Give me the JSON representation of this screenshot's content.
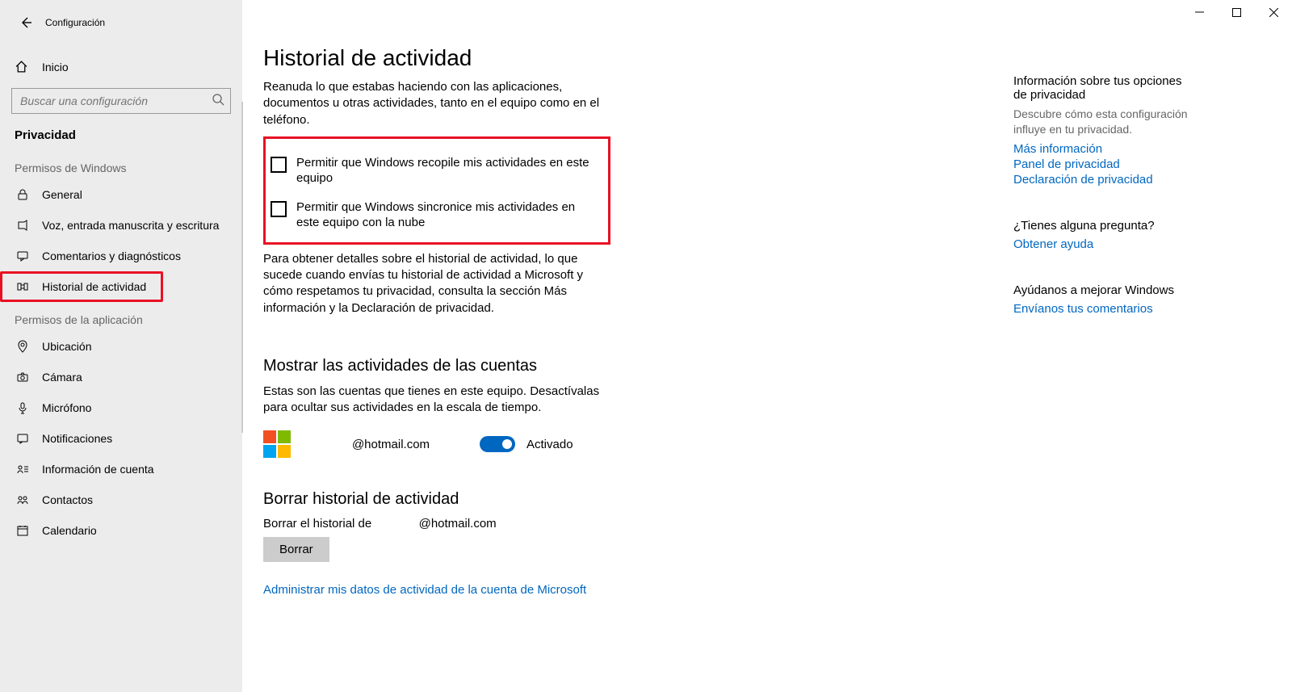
{
  "titlebar": {
    "app_title": "Configuración"
  },
  "sidebar": {
    "home_label": "Inicio",
    "search_placeholder": "Buscar una configuración",
    "category": "Privacidad",
    "group_windows": "Permisos de Windows",
    "group_apps": "Permisos de la aplicación",
    "items_windows": [
      {
        "label": "General"
      },
      {
        "label": "Voz, entrada manuscrita y escritura"
      },
      {
        "label": "Comentarios y diagnósticos"
      },
      {
        "label": "Historial de actividad"
      }
    ],
    "items_apps": [
      {
        "label": "Ubicación"
      },
      {
        "label": "Cámara"
      },
      {
        "label": "Micrófono"
      },
      {
        "label": "Notificaciones"
      },
      {
        "label": "Información de cuenta"
      },
      {
        "label": "Contactos"
      },
      {
        "label": "Calendario"
      }
    ]
  },
  "page": {
    "title": "Historial de actividad",
    "intro": "Reanuda lo que estabas haciendo con las aplicaciones, documentos u otras actividades, tanto en el equipo como en el teléfono.",
    "cb1": "Permitir que Windows recopile mis actividades en este equipo",
    "cb2": "Permitir que Windows sincronice mis actividades en este equipo con la nube",
    "details": "Para obtener detalles sobre el historial de actividad, lo que sucede cuando envías tu historial de actividad a Microsoft y cómo respetamos tu privacidad, consulta la sección Más información y la Declaración de privacidad.",
    "accounts_heading": "Mostrar las actividades de las cuentas",
    "accounts_desc": "Estas son las cuentas que tienes en este equipo. Desactívalas para ocultar sus actividades en la escala de tiempo.",
    "account_email": "@hotmail.com",
    "toggle_state": "Activado",
    "clear_heading": "Borrar historial de actividad",
    "clear_label_prefix": "Borrar el historial de",
    "clear_label_email": "@hotmail.com",
    "clear_button": "Borrar",
    "manage_link": "Administrar mis datos de actividad de la cuenta de Microsoft"
  },
  "aside": {
    "privacy_head": "Información sobre tus opciones de privacidad",
    "privacy_desc": "Descubre cómo esta configuración influye en tu privacidad.",
    "link_more": "Más información",
    "link_panel": "Panel de privacidad",
    "link_decl": "Declaración de privacidad",
    "question_head": "¿Tienes alguna pregunta?",
    "link_help": "Obtener ayuda",
    "improve_head": "Ayúdanos a mejorar Windows",
    "link_feedback": "Envíanos tus comentarios"
  }
}
